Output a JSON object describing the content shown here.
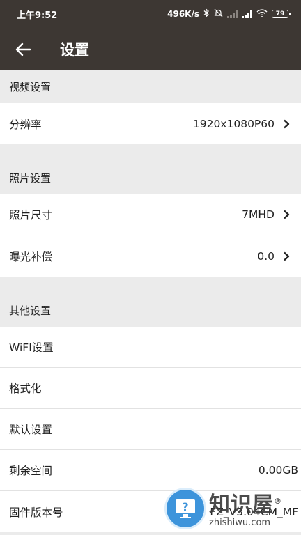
{
  "status_bar": {
    "time": "上午9:52",
    "net_speed": "496K/s",
    "battery": "79"
  },
  "header": {
    "title": "设置"
  },
  "sections": {
    "video": {
      "header": "视频设置",
      "resolution": {
        "label": "分辨率",
        "value": "1920x1080P60"
      }
    },
    "photo": {
      "header": "照片设置",
      "photo_size": {
        "label": "照片尺寸",
        "value": "7MHD"
      },
      "exposure": {
        "label": "曝光补偿",
        "value": "0.0"
      }
    },
    "other": {
      "header": "其他设置",
      "wifi": {
        "label": "WiFI设置"
      },
      "format": {
        "label": "格式化"
      },
      "defaults": {
        "label": "默认设置"
      },
      "storage": {
        "label": "剩余空间",
        "value": "0.00GB"
      },
      "firmware": {
        "label": "固件版本号",
        "value": "FZ_V3.04CM_MF"
      }
    }
  },
  "watermark": {
    "text_cn": "知识屋",
    "reg": "®",
    "text_en": "zhishiwu.com"
  },
  "colors": {
    "appbar": "#3d3733",
    "page_bg": "#ebebeb",
    "row_bg": "#ffffff",
    "watermark_blue": "#2d8bd8"
  }
}
